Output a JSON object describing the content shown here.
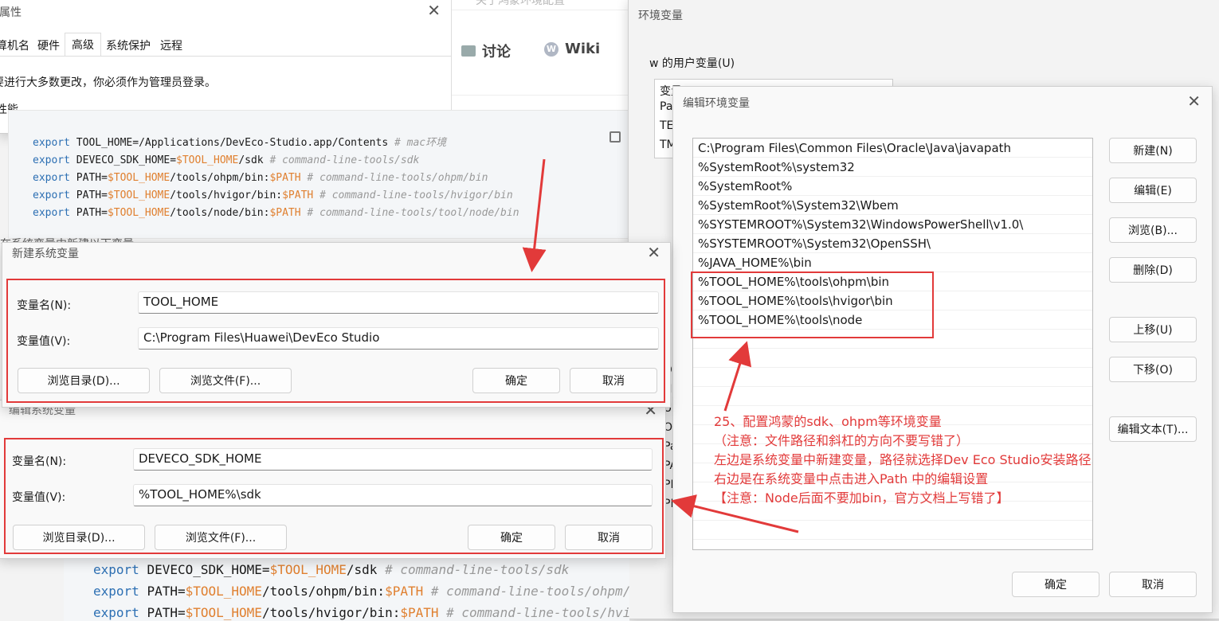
{
  "props_win": {
    "title": "属性",
    "tabs": [
      "计算机名",
      "硬件",
      "高级",
      "系统保护",
      "远程"
    ],
    "active_tab": "高级",
    "notice": "要进行大多数更改，你必须作为管理员登录。",
    "section": "性能",
    "partial_line": "在系统变量中新建以下变量"
  },
  "web_page": {
    "title": "关于鸿蒙环境配置",
    "nav": [
      {
        "icon": "chat-icon",
        "label": "讨论"
      },
      {
        "icon": "wiki-icon",
        "label": "Wiki"
      }
    ]
  },
  "code_top": [
    {
      "kw": "export ",
      "name": "TOOL_HOME=",
      "v": "",
      "rest": "/Applications/DevEco-Studio.app/Contents ",
      "cm": "# mac环境"
    },
    {
      "kw": "export ",
      "name": "DEVECO_SDK_HOME=",
      "v": "$TOOL_HOME",
      "rest": "/sdk ",
      "cm": "# command-line-tools/sdk"
    },
    {
      "kw": "export ",
      "name": "PATH=",
      "v": "$TOOL_HOME",
      "rest": "/tools/ohpm/bin:",
      "v2": "$PATH",
      "cm": " # command-line-tools/ohpm/bin"
    },
    {
      "kw": "export ",
      "name": "PATH=",
      "v": "$TOOL_HOME",
      "rest": "/tools/hvigor/bin:",
      "v2": "$PATH",
      "cm": " # command-line-tools/hvigor/bin"
    },
    {
      "kw": "export ",
      "name": "PATH=",
      "v": "$TOOL_HOME",
      "rest": "/tools/node/bin:",
      "v2": "$PATH",
      "cm": " # command-line-tools/tool/node/bin"
    }
  ],
  "code_bottom": [
    {
      "kw": "export ",
      "name": "DEVECO_SDK_HOME=",
      "v": "$TOOL_HOME",
      "rest": "/sdk ",
      "cm": "# command-line-tools/sdk"
    },
    {
      "kw": "export ",
      "name": "PATH=",
      "v": "$TOOL_HOME",
      "rest": "/tools/ohpm/bin:",
      "v2": "$PATH",
      "cm": " # command-line-tools/ohpm/"
    },
    {
      "kw": "export ",
      "name": "PATH=",
      "v": "$TOOL_HOME",
      "rest": "/tools/hvigor/bin:",
      "v2": "$PATH",
      "cm": " # command-line-tools/hvi"
    }
  ],
  "new_var": {
    "title": "新建系统变量",
    "name_label": "变量名(N):",
    "name_value": "TOOL_HOME",
    "value_label": "变量值(V):",
    "value_value": "C:\\Program Files\\Huawei\\DevEco Studio",
    "browse_dir": "浏览目录(D)...",
    "browse_file": "浏览文件(F)...",
    "ok": "确定",
    "cancel": "取消"
  },
  "edit_var": {
    "title": "编辑系统变量",
    "name_label": "变量名(N):",
    "name_value": "DEVECO_SDK_HOME",
    "value_label": "变量值(V):",
    "value_value": "%TOOL_HOME%\\sdk",
    "browse_dir": "浏览目录(D)...",
    "browse_file": "浏览文件(F)...",
    "ok": "确定",
    "cancel": "取消"
  },
  "env_win": {
    "title": "环境变量",
    "user_group": "w 的用户变量(U)",
    "user_rows": [
      "变量",
      "Pa",
      "TE",
      "TM"
    ],
    "sys_fragments": [
      "D",
      "N",
      "U",
      "OS",
      "Pa",
      "PA",
      "PR",
      "PR"
    ]
  },
  "edit_env": {
    "title": "编辑环境变量",
    "paths": [
      "C:\\Program Files\\Common Files\\Oracle\\Java\\javapath",
      "%SystemRoot%\\system32",
      "%SystemRoot%",
      "%SystemRoot%\\System32\\Wbem",
      "%SYSTEMROOT%\\System32\\WindowsPowerShell\\v1.0\\",
      "%SYSTEMROOT%\\System32\\OpenSSH\\",
      "%JAVA_HOME%\\bin",
      "%TOOL_HOME%\\tools\\ohpm\\bin",
      "%TOOL_HOME%\\tools\\hvigor\\bin",
      "%TOOL_HOME%\\tools\\node"
    ],
    "buttons": {
      "new": "新建(N)",
      "edit": "编辑(E)",
      "browse": "浏览(B)...",
      "delete": "删除(D)",
      "up": "上移(U)",
      "down": "下移(O)",
      "edit_text": "编辑文本(T)...",
      "ok": "确定",
      "cancel": "取消"
    }
  },
  "annotation": {
    "line1": "25、配置鸿蒙的sdk、ohpm等环境变量",
    "line2": "（注意：文件路径和斜杠的方向不要写错了）",
    "line3": "左边是系统变量中新建变量，路径就选择Dev Eco Studio安装路径",
    "line4": "右边是在系统变量中点击进入Path 中的编辑设置",
    "line5": "【注意：Node后面不要加bin，官方文档上写错了】"
  },
  "colors": {
    "annotation_red": "#e23a3a",
    "code_keyword": "#2c6fb3",
    "code_var": "#e08030",
    "code_comment": "#999999"
  }
}
